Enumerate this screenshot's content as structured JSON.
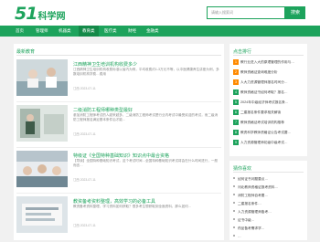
{
  "header": {
    "logo_number": "51",
    "logo_text": "科学网",
    "search_placeholder": "请输入搜索词",
    "search_button": "搜索"
  },
  "nav": {
    "items": [
      {
        "label": "首页",
        "active": false
      },
      {
        "label": "管理师",
        "active": false
      },
      {
        "label": "机器类",
        "active": false
      },
      {
        "label": "教育类",
        "active": true
      },
      {
        "label": "医疗类",
        "active": false
      },
      {
        "label": "财经",
        "active": false
      },
      {
        "label": "金融类",
        "active": false
      }
    ]
  },
  "main": {
    "section_title": "最新教育",
    "articles": [
      {
        "title": "江西精神卫生培训机构收费多少",
        "desc": "江西精神卫生培训机构收费标准以省内为例，平均收费约1-3万元不等，以中医健康养生讲座为例，多数培训机构学费…费用",
        "date": "江西 2023-07-11"
      },
      {
        "title": "二级消防工程师哪种类型最好",
        "desc": "参加消防工程师考试的人越来越多，二级消防工程师考试是行业内考试中最受欢迎的考试，而二级消防工程师报名满足基本条件后才能…",
        "date": "江西 2023-07-11"
      },
      {
        "title": "特级证《全国特种基础知识》知识点中最合资格",
        "desc": "【导读】全国特种基础知识考试，这个考试时间…全国特种基础知识考试将会在什么时间进行，一般而言…",
        "date": "江西 2023-07-11"
      },
      {
        "title": "教资备考资料整理，高效学习的必备工具",
        "desc": "教资备考资料整理，学习资料如何获取？很多考生想获取到全面资料，那么如何…",
        "date": "江西 2023-07-11"
      }
    ]
  },
  "sidebar_hot": {
    "title": "点击排行",
    "items": [
      "教行业进入大的原理管理的作用与…",
      "教师资格证查询难度分析",
      "人大力资源管理师报名时间分…",
      "教师资格证书如何考取？报名…",
      "2024年中级经济师考试报名条…",
      "二建报名条件要求相关解读",
      "教师资格证考试培训机构推荐",
      "教资科学教师资格证公告考试要…",
      "人力资源管理师初级中级考试…"
    ]
  },
  "sidebar_rec": {
    "title": "猜你喜欢",
    "items": [
      "如何证书问题要点…",
      "河北教师资格证报考资料…",
      "消防工程师自考要…",
      "二建报名条件…",
      "人力资源管理师备考…",
      "证书中级…",
      "药品备考需求学…",
      "…"
    ]
  }
}
